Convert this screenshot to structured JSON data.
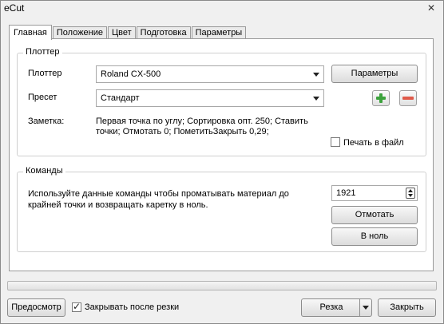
{
  "window": {
    "title": "eCut",
    "close_label": "✕"
  },
  "tabs": [
    "Главная",
    "Положение",
    "Цвет",
    "Подготовка",
    "Параметры"
  ],
  "plotter_group": {
    "title": "Плоттер",
    "plotter_label": "Плоттер",
    "plotter_value": "Roland CX-500",
    "params_button": "Параметры",
    "preset_label": "Пресет",
    "preset_value": "Стандарт",
    "note_label": "Заметка:",
    "note_line1": "Первая точка по углу; Сортировка опт. 250; Ставить",
    "note_line2": "точки; Отмотать 0; ПометитьЗакрыть 0,29;",
    "print_to_file_label": "Печать в файл",
    "print_to_file_checked": false
  },
  "commands_group": {
    "title": "Команды",
    "desc_line1": "Используйте данные команды чтобы проматывать материал до",
    "desc_line2": "крайней точки и возвращать каретку в ноль.",
    "amount_value": "1921",
    "rewind_button": "Отмотать",
    "zero_button": "В ноль"
  },
  "footer": {
    "preview_button": "Предосмотр",
    "close_after_cut_label": "Закрывать после резки",
    "close_after_cut_checked": true,
    "cut_button": "Резка",
    "close_button": "Закрыть"
  }
}
